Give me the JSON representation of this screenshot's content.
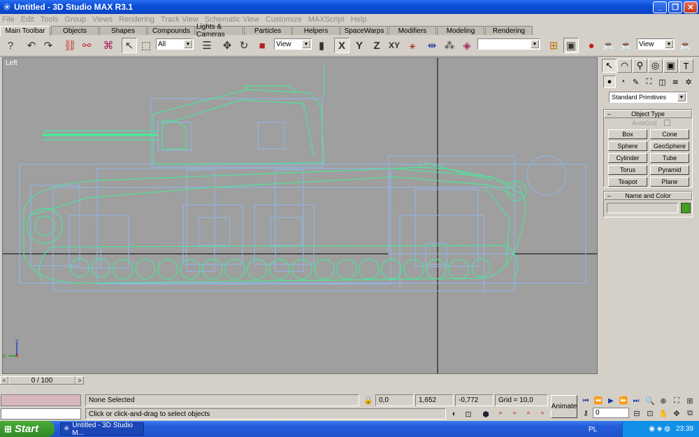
{
  "window": {
    "title": "Untitled - 3D Studio MAX R3.1"
  },
  "menu": [
    "File",
    "Edit",
    "Tools",
    "Group",
    "Views",
    "Rendering",
    "Track View",
    "Schematic View",
    "Customize",
    "MAXScript",
    "Help"
  ],
  "tabs": [
    "Main Toolbar",
    "Objects",
    "Shapes",
    "Compounds",
    "Lights & Cameras",
    "Particles",
    "Helpers",
    "SpaceWarps",
    "Modifiers",
    "Modeling",
    "Rendering"
  ],
  "toolbar": {
    "filter_value": "All",
    "refcoord_value": "View",
    "axis_x": "X",
    "axis_y": "Y",
    "axis_z": "Z",
    "axis_xy": "XY",
    "named_sel_value": "",
    "render_view_value": "View"
  },
  "viewport": {
    "label": "Left",
    "axis_z": "z",
    "axis_y": "y",
    "axis_x": "x"
  },
  "command_panel": {
    "category": "Standard Primitives",
    "object_type_title": "Object Type",
    "autogrid_label": "AutoGrid",
    "primitives": [
      "Box",
      "Cone",
      "Sphere",
      "GeoSphere",
      "Cylinder",
      "Tube",
      "Torus",
      "Pyramid",
      "Teapot",
      "Plane"
    ],
    "name_color_title": "Name and Color",
    "name_value": "",
    "color": "#40a020"
  },
  "timeslider": {
    "frame_label": "0 / 100"
  },
  "status": {
    "selection": "None Selected",
    "prompt": "Click or click-and-drag to select objects",
    "x": "0,0",
    "y": "1,652",
    "z": "-0,772",
    "grid": "Grid = 10,0",
    "animate": "Animate",
    "frame": "0"
  },
  "taskbar": {
    "start": "Start",
    "task": "Untitled - 3D Studio M...",
    "lang": "PL",
    "clock": "23:39"
  }
}
